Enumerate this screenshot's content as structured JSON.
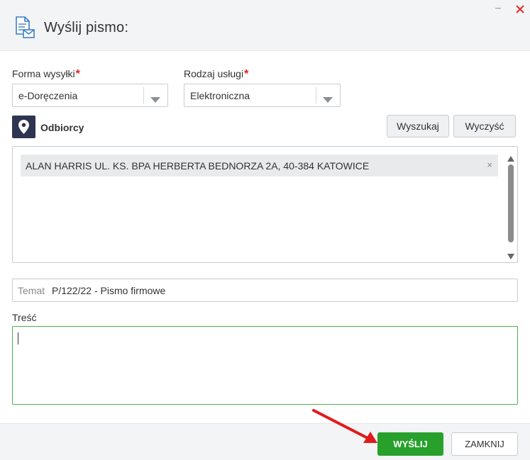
{
  "header": {
    "title": "Wyślij pismo:",
    "minimize_glyph": "−",
    "icons": {
      "document": "document-mail-icon",
      "close": "close-icon"
    }
  },
  "form": {
    "delivery_form": {
      "label": "Forma wysyłki",
      "required_mark": "*",
      "value": "e-Doręczenia"
    },
    "service_type": {
      "label": "Rodzaj usługi",
      "required_mark": "*",
      "value": "Elektroniczna"
    }
  },
  "recipients": {
    "section_label": "Odbiorcy",
    "search_button": "Wyszukaj",
    "clear_button": "Wyczyść",
    "items": [
      {
        "text": "ALAN HARRIS UL. KS. BPA HERBERTA BEDNORZA 2A, 40-384 KATOWICE",
        "remove_glyph": "×"
      }
    ]
  },
  "subject": {
    "prefix": "Temat",
    "value": "P/122/22 - Pismo firmowe"
  },
  "body": {
    "label": "Treść",
    "value": ""
  },
  "footer": {
    "send_button": "WYŚLIJ",
    "close_button": "ZAMKNIJ"
  },
  "colors": {
    "accent_green": "#27a02c",
    "required_red": "#e11d1d",
    "pin_background": "#2f3450",
    "annotation_arrow": "#e01b1b"
  }
}
